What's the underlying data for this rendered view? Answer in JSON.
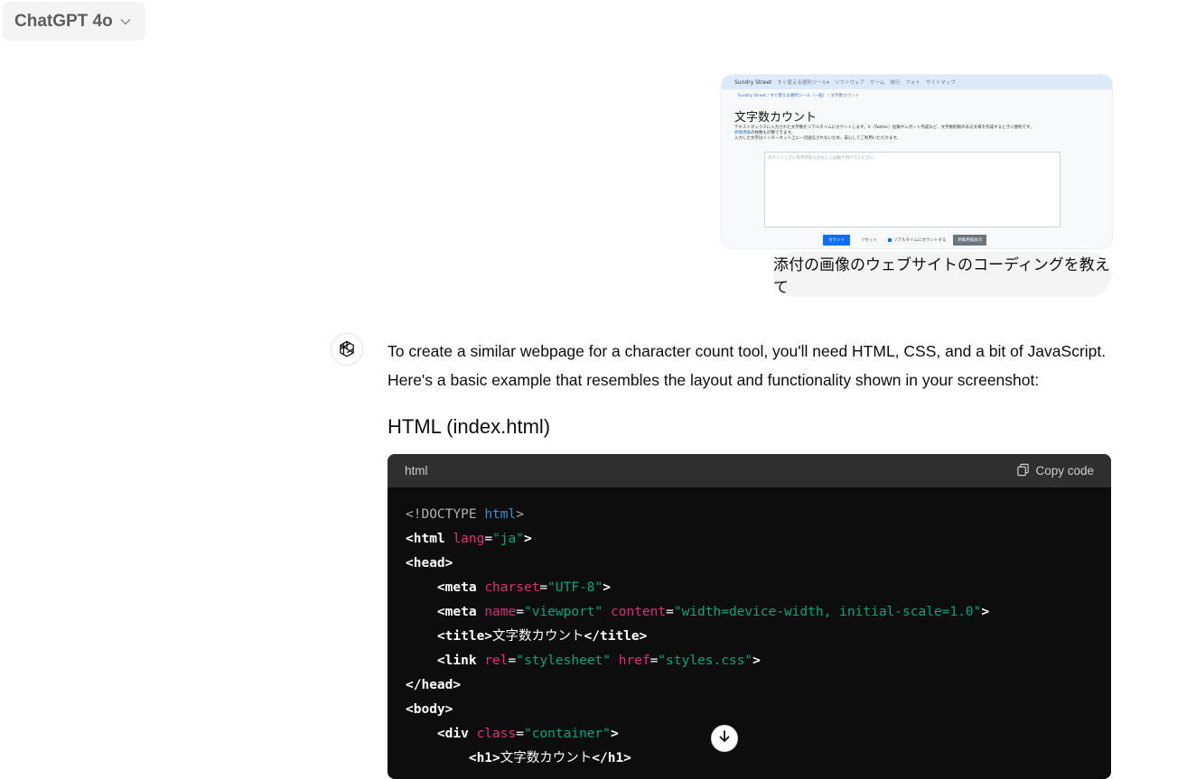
{
  "header": {
    "model_label": "ChatGPT 4o",
    "chevron_icon": "chevron-down-icon"
  },
  "attachment": {
    "site": {
      "brand": "Sundry Street",
      "nav": [
        "すぐ使える便利ツール▾",
        "ソフトウェア",
        "ゲーム",
        "旅行",
        "フォト",
        "サイトマップ"
      ],
      "breadcrumb": [
        "Sundry Street",
        "すぐ使える便利ツール（一般）",
        "文字数カウント"
      ],
      "heading": "文字数カウント",
      "desc_line1": "テキストボックスに入力された文字数をリアルタイムにカウントします。X（Twitter）投稿やレポート作成など、文字数制限のある文章を作成するときに便利です。",
      "desc_link": "原稿用紙",
      "desc_line2": "の枚数も計算できます。",
      "desc_line3": "入力した文字はインターネット上に一切送信されないため、安心してご利用いただけます。",
      "textarea_placeholder": "カウントしたい文字列を入力もしくは貼り付けてください。",
      "count_button": "カウント",
      "reset_button": "リセット",
      "realtime_checkbox": "リアルタイムにカウントする",
      "detail_button": "原稿用紙表示"
    }
  },
  "user_message": "添付の画像のウェブサイトのコーディングを教えて",
  "assistant": {
    "avatar_icon": "openai-logo-icon",
    "paragraph": "To create a similar webpage for a character count tool, you'll need HTML, CSS, and a bit of JavaScript. Here's a basic example that resembles the layout and functionality shown in your screenshot:",
    "section_heading": "HTML (index.html)",
    "code_block": {
      "language": "html",
      "copy_label": "Copy code",
      "copy_icon": "copy-icon",
      "lines": {
        "l1_a": "<!DOCTYPE ",
        "l1_b": "html",
        "l1_c": ">",
        "l2_tag": "<html",
        "l2_attr": "lang",
        "l2_eq": "=",
        "l2_val": "\"ja\"",
        "l2_end": ">",
        "l3": "<head>",
        "l4_tag": "<meta",
        "l4_attr": "charset",
        "l4_eq": "=",
        "l4_val": "\"UTF-8\"",
        "l4_end": ">",
        "l5_tag": "<meta",
        "l5_attr1": "name",
        "l5_eq1": "=",
        "l5_val1": "\"viewport\"",
        "l5_attr2": "content",
        "l5_eq2": "=",
        "l5_val2": "\"width=device-width, initial-scale=1.0\"",
        "l5_end": ">",
        "l6_open": "<title>",
        "l6_text": "文字数カウント",
        "l6_close": "</title>",
        "l7_tag": "<link",
        "l7_attr1": "rel",
        "l7_eq1": "=",
        "l7_val1": "\"stylesheet\"",
        "l7_attr2": "href",
        "l7_eq2": "=",
        "l7_val2": "\"styles.css\"",
        "l7_end": ">",
        "l8": "</head>",
        "l9": "<body>",
        "l10_tag": "<div",
        "l10_attr": "class",
        "l10_eq": "=",
        "l10_val": "\"container\"",
        "l10_end": ">",
        "l11_open": "<h1>",
        "l11_text": "文字数カウント",
        "l11_close": "</h1>"
      }
    }
  },
  "scroll_button_icon": "arrow-down-icon"
}
